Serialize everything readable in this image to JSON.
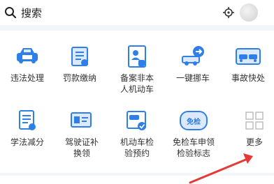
{
  "search": {
    "label": "搜索"
  },
  "services_row1": [
    {
      "label": "违法处理",
      "icon": "car-violation-icon"
    },
    {
      "label": "罚款缴纳",
      "icon": "fine-payment-icon"
    },
    {
      "label": "备案非本\n人机动车",
      "icon": "vehicle-registration-icon"
    },
    {
      "label": "一键挪车",
      "icon": "move-car-icon"
    },
    {
      "label": "事故快处",
      "icon": "accident-icon"
    }
  ],
  "services_row2": [
    {
      "label": "学法减分",
      "icon": "study-deduction-icon"
    },
    {
      "label": "驾驶证补\n换领",
      "icon": "license-renewal-icon"
    },
    {
      "label": "机动车检\n验预约",
      "icon": "inspection-booking-icon"
    },
    {
      "label": "免检车申领\n检验标志",
      "icon": "inspection-exempt-icon",
      "badge": "免检"
    },
    {
      "label": "更多",
      "icon": "more-grid-icon"
    }
  ],
  "colors": {
    "accent": "#2f7fe8",
    "light": "#dbe9fb",
    "arrow": "#e53935",
    "more": "#bdbdbd"
  }
}
